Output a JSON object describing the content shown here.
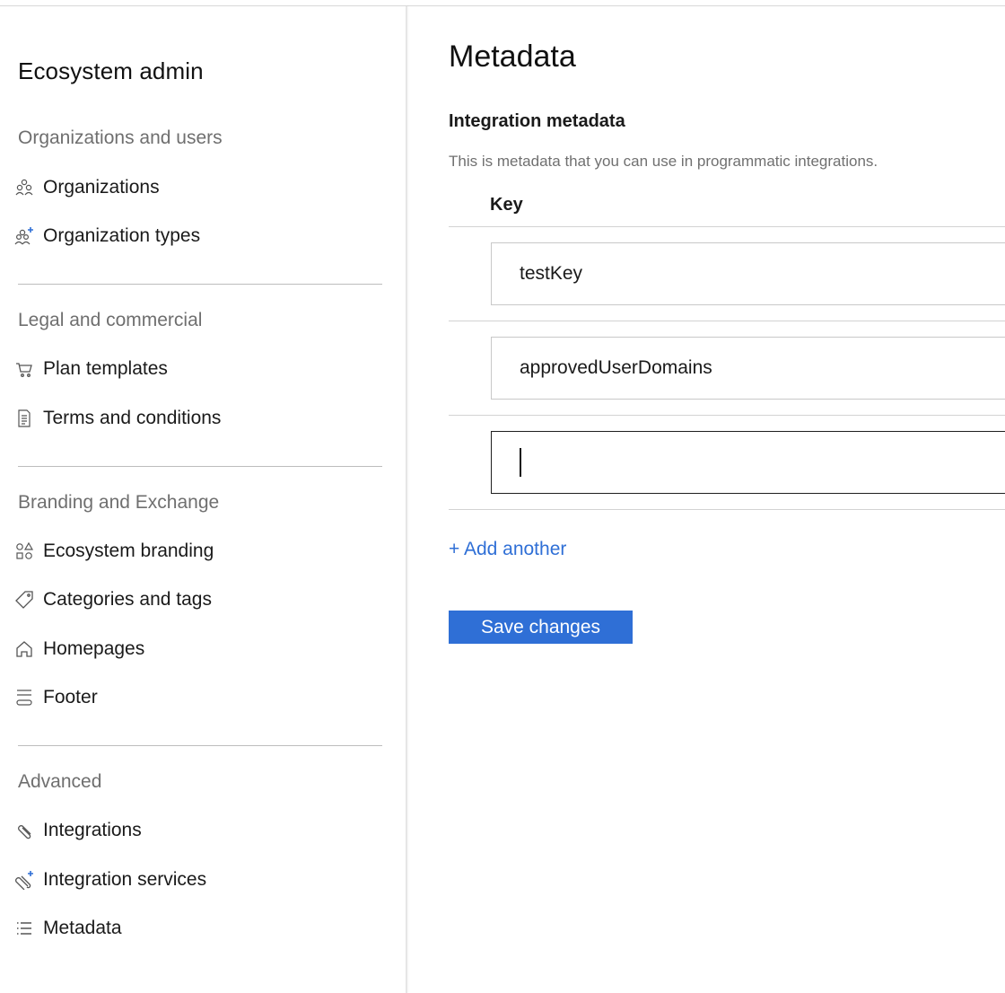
{
  "sidebar": {
    "title": "Ecosystem admin",
    "sections": [
      {
        "heading": "Organizations and users",
        "items": [
          {
            "label": "Organizations",
            "icon": "people-group-icon"
          },
          {
            "label": "Organization types",
            "icon": "people-group-plus-icon"
          }
        ]
      },
      {
        "heading": "Legal and commercial",
        "items": [
          {
            "label": "Plan templates",
            "icon": "cart-icon"
          },
          {
            "label": "Terms and conditions",
            "icon": "document-icon"
          }
        ]
      },
      {
        "heading": "Branding and Exchange",
        "items": [
          {
            "label": "Ecosystem branding",
            "icon": "shapes-icon"
          },
          {
            "label": "Categories and tags",
            "icon": "tag-icon"
          },
          {
            "label": "Homepages",
            "icon": "home-icon"
          },
          {
            "label": "Footer",
            "icon": "footer-icon"
          }
        ]
      },
      {
        "heading": "Advanced",
        "items": [
          {
            "label": "Integrations",
            "icon": "paperclip-icon"
          },
          {
            "label": "Integration services",
            "icon": "paperclip-plus-icon"
          },
          {
            "label": "Metadata",
            "icon": "list-icon"
          }
        ]
      }
    ]
  },
  "main": {
    "title": "Metadata",
    "subtitle": "Integration metadata",
    "description": "This is metadata that you can use in programmatic integrations.",
    "column_header": "Key",
    "rows": [
      {
        "value": "testKey"
      },
      {
        "value": "approvedUserDomains"
      },
      {
        "value": ""
      }
    ],
    "add_another": "+ Add another",
    "save_label": "Save changes"
  },
  "colors": {
    "accent": "#2f6fd6",
    "plus_accent": "#2f6fd6",
    "section_heading": "#6f6f6f"
  }
}
